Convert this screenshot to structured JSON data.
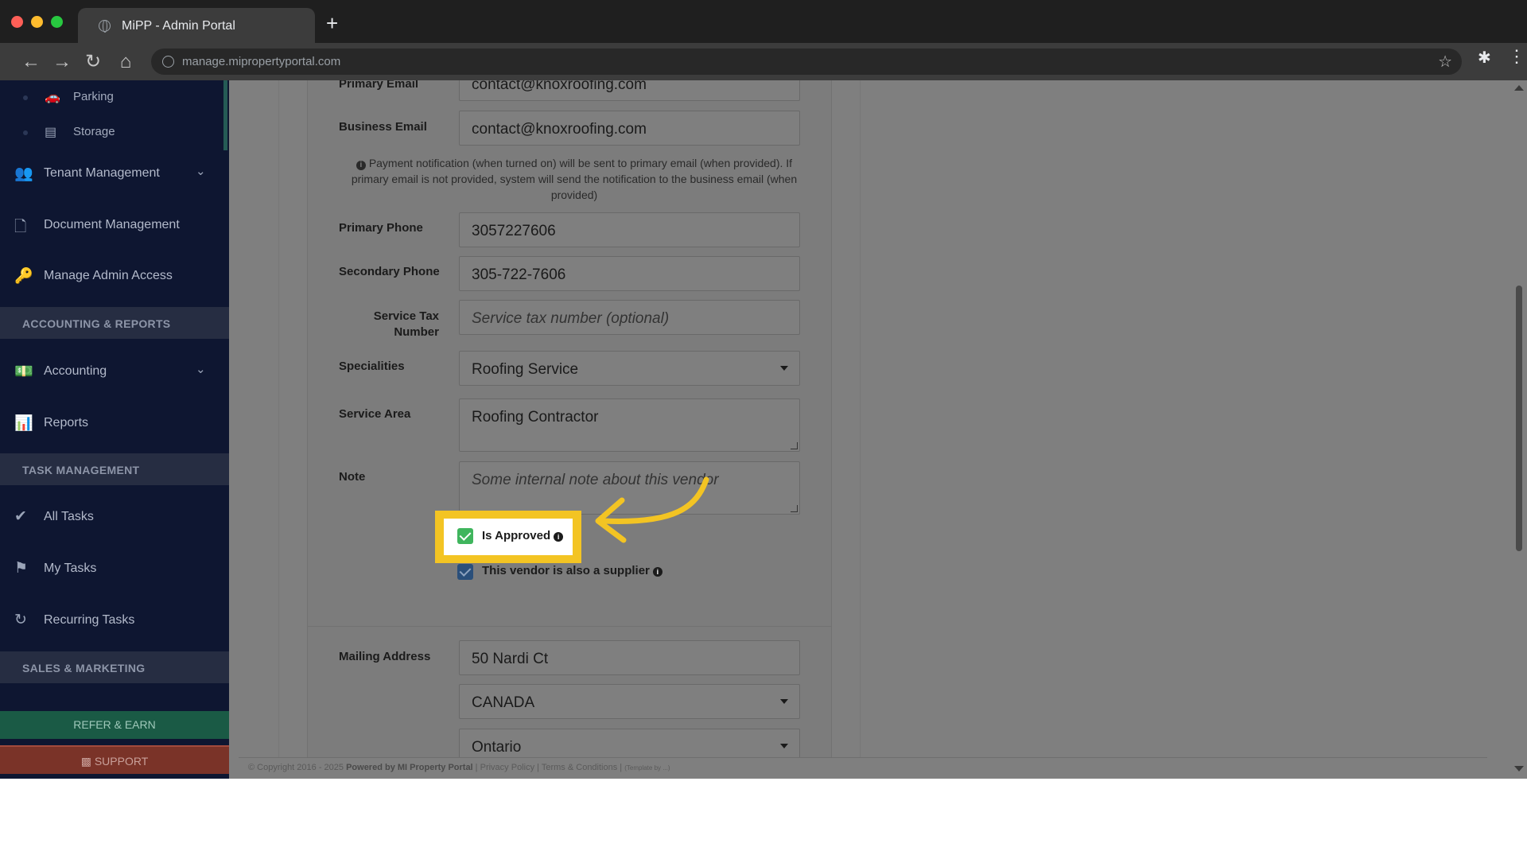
{
  "browser": {
    "tab_title": "MiPP - Admin Portal",
    "new_tab": "+",
    "url": "manage.mipropertyportal.com"
  },
  "sidebar": {
    "sub_items": [
      {
        "label": "Parking",
        "icon": "car-icon"
      },
      {
        "label": "Storage",
        "icon": "storage-icon"
      }
    ],
    "items": {
      "tenant": "Tenant Management",
      "document": "Document Management",
      "admin_access": "Manage Admin Access",
      "accounting": "Accounting",
      "reports": "Reports",
      "all_tasks": "All Tasks",
      "my_tasks": "My Tasks",
      "recurring": "Recurring Tasks"
    },
    "sections": {
      "accounting_reports": "ACCOUNTING & REPORTS",
      "task_management": "TASK MANAGEMENT",
      "sales_marketing": "SALES & MARKETING"
    },
    "refer": "REFER & EARN",
    "support": "SUPPORT"
  },
  "form": {
    "primary_email": {
      "label": "Primary Email",
      "value": "contact@knoxroofing.com"
    },
    "business_email": {
      "label": "Business Email",
      "value": "contact@knoxroofing.com"
    },
    "notice": "Payment notification (when turned on) will be sent to primary email (when provided). If primary email is not provided, system will send the notification to the business email (when provided)",
    "primary_phone": {
      "label": "Primary Phone",
      "value": "3057227606"
    },
    "secondary_phone": {
      "label": "Secondary Phone",
      "value": "305-722-7606"
    },
    "service_tax": {
      "label_line1": "Service Tax",
      "label_line2": "Number",
      "placeholder": "Service tax number (optional)"
    },
    "specialities": {
      "label": "Specialities",
      "value": "Roofing Service"
    },
    "service_area": {
      "label": "Service Area",
      "value": "Roofing Contractor"
    },
    "note": {
      "label": "Note",
      "placeholder": "Some internal note about this vendor"
    },
    "is_approved": {
      "label": "Is Approved",
      "checked": true
    },
    "is_supplier": {
      "label": "This vendor is also a supplier",
      "checked": true
    },
    "mailing_address": {
      "label": "Mailing Address",
      "value": "50 Nardi Ct"
    },
    "country": {
      "value": "CANADA"
    },
    "province": {
      "value": "Ontario"
    }
  },
  "footer": {
    "copyright": "© Copyright 2016 - 2025",
    "powered": "Powered by MI Property Portal",
    "privacy": "Privacy Policy",
    "terms": "Terms & Conditions",
    "template": "(Template by ...)"
  },
  "colors": {
    "sidebar_bg": "#0e1631",
    "highlight": "#f3c423",
    "approved_check": "#3fb55d",
    "supplier_check": "#2a4f7a"
  }
}
